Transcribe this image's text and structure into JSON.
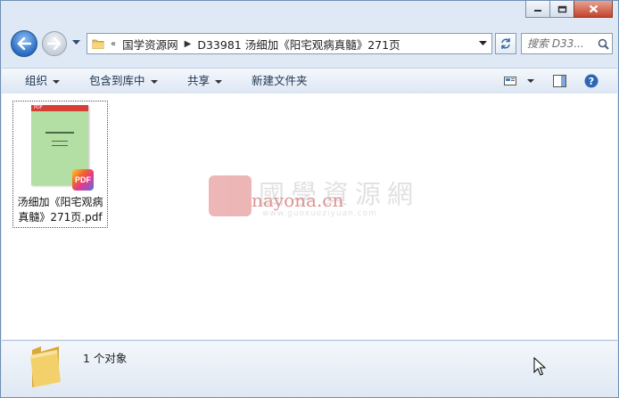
{
  "address": {
    "overflow_marker": "«",
    "crumbs": [
      "国学资源网",
      "D33981 汤细加《阳宅观病真髓》271页"
    ]
  },
  "search": {
    "placeholder": "搜索 D33..."
  },
  "toolbar": {
    "organize": "组织",
    "include_in_library": "包含到库中",
    "share": "共享",
    "new_folder": "新建文件夹"
  },
  "file": {
    "name_line1": "汤细加《阳宅观病",
    "name_line2": "真髓》271页.pdf",
    "badge": "PDF",
    "thumb_band": "PDF"
  },
  "watermark": {
    "cn": "國學資源網",
    "en": "nayona.cn",
    "url": "www.guoxueziyuan.com"
  },
  "status": {
    "count": "1 个对象"
  },
  "colors": {
    "accent": "#2a6bc2",
    "close": "#c2432a",
    "pdf_thumb": "#b3dea4",
    "pdf_band": "#d63e36"
  }
}
